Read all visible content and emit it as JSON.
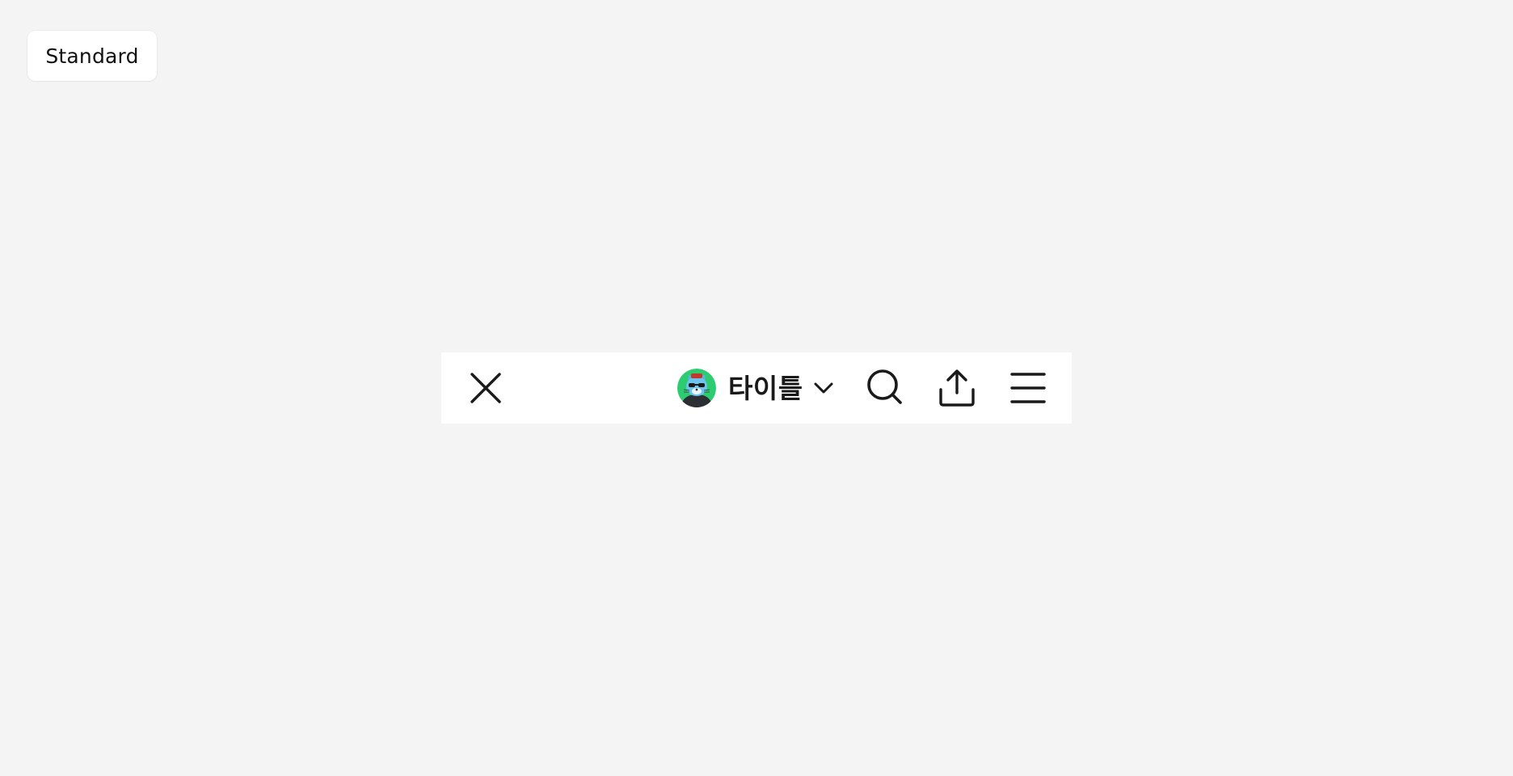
{
  "variant_label": "Standard",
  "navbar": {
    "title": "타이틀",
    "left_icon": "close-icon",
    "avatar_icon": "cat-avatar",
    "title_dropdown_icon": "chevron-down-icon",
    "right_icons": [
      "search-icon",
      "share-upload-icon",
      "menu-icon"
    ]
  },
  "colors": {
    "page_background": "#f4f4f4",
    "bar_background": "#ffffff",
    "icon": "#1a1a1a",
    "avatar_background": "#2ecc71"
  }
}
